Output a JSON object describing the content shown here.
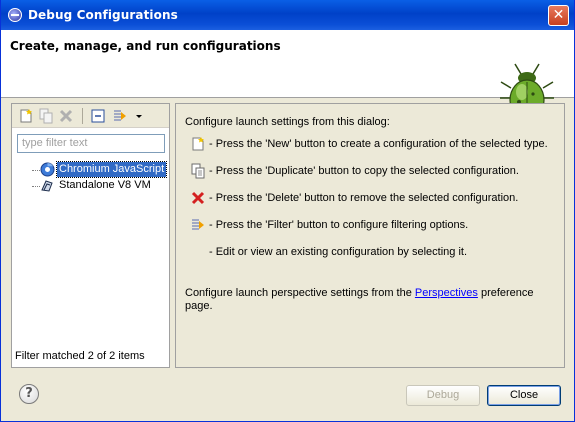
{
  "window": {
    "title": "Debug Configurations",
    "close_label": "✕"
  },
  "header": {
    "title": "Create, manage, and run configurations"
  },
  "left": {
    "filter_placeholder": "type filter text",
    "tree": [
      {
        "label": "Chromium JavaScript",
        "icon": "chromium-icon",
        "selected": true
      },
      {
        "label": "Standalone V8 VM",
        "icon": "v8-vm-icon",
        "selected": false
      }
    ],
    "filter_status": "Filter matched 2 of 2 items",
    "toolbar": [
      "new-config-icon",
      "duplicate-icon",
      "delete-icon",
      "collapse-all-icon",
      "filter-icon",
      "dropdown-arrow-icon"
    ]
  },
  "right": {
    "intro": "Configure launch settings from this dialog:",
    "rows": [
      {
        "icon": "new-icon",
        "text": "- Press the 'New' button to create a configuration of the selected type."
      },
      {
        "icon": "duplicate-icon",
        "text": "- Press the 'Duplicate' button to copy the selected configuration."
      },
      {
        "icon": "delete-icon",
        "text": "- Press the 'Delete' button to remove the selected configuration."
      },
      {
        "icon": "filter-icon",
        "text": "- Press the 'Filter' button to configure filtering options."
      }
    ],
    "edit_text": "- Edit or view an existing configuration by selecting it.",
    "persp_before": "Configure launch perspective settings from the ",
    "persp_link": "Perspectives",
    "persp_after": " preference page."
  },
  "footer": {
    "help": "?",
    "debug_label": "Debug",
    "close_label": "Close"
  },
  "colors": {
    "title_bar": "#0a4ed6",
    "selection": "#316ac5",
    "delete_red": "#d42020",
    "link": "#0000ff"
  }
}
